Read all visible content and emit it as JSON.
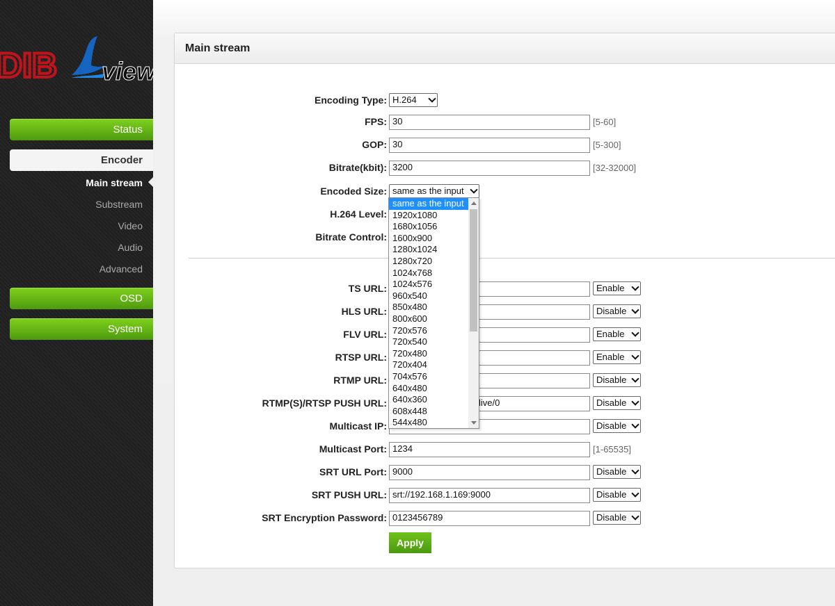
{
  "brand": {
    "part1": "DIB",
    "part2": "view"
  },
  "sidebar": {
    "status": "Status",
    "encoder": "Encoder",
    "encoder_items": [
      "Main stream",
      "Substream",
      "Video",
      "Audio",
      "Advanced"
    ],
    "osd": "OSD",
    "system": "System"
  },
  "panel": {
    "title": "Main stream"
  },
  "form": {
    "encoding_type": {
      "label": "Encoding Type:",
      "value": "H.264"
    },
    "fps": {
      "label": "FPS:",
      "value": "30",
      "range": "[5-60]"
    },
    "gop": {
      "label": "GOP:",
      "value": "30",
      "range": "[5-300]"
    },
    "bitrate": {
      "label": "Bitrate(kbit):",
      "value": "3200",
      "range": "[32-32000]"
    },
    "encoded_size": {
      "label": "Encoded Size:",
      "value": "same as the input"
    },
    "h264_level": {
      "label": "H.264 Level:"
    },
    "bitrate_control": {
      "label": "Bitrate Control:"
    },
    "ts_url": {
      "label": "TS URL:",
      "state": "Enable"
    },
    "hls_url": {
      "label": "HLS URL:",
      "state": "Disable"
    },
    "flv_url": {
      "label": "FLV URL:",
      "state": "Enable"
    },
    "rtsp_url": {
      "label": "RTSP URL:",
      "state": "Enable"
    },
    "rtmp_url": {
      "label": "RTMP URL:",
      "state": "Disable"
    },
    "push_url": {
      "label": "RTMP(S)/RTSP PUSH URL:",
      "value_visible": "live/0",
      "state": "Disable"
    },
    "multicast_ip": {
      "label": "Multicast IP:",
      "state": "Disable"
    },
    "multicast_port": {
      "label": "Multicast Port:",
      "value": "1234",
      "range": "[1-65535]"
    },
    "srt_url_port": {
      "label": "SRT URL Port:",
      "value": "9000",
      "state": "Disable"
    },
    "srt_push_url": {
      "label": "SRT PUSH URL:",
      "value": "srt://192.168.1.169:9000",
      "state": "Disable"
    },
    "srt_password": {
      "label": "SRT Encryption Password:",
      "value": "0123456789",
      "state": "Disable"
    },
    "apply": "Apply"
  },
  "dropdown_options": [
    "same as the input",
    "1920x1080",
    "1680x1056",
    "1600x900",
    "1280x1024",
    "1280x720",
    "1024x768",
    "1024x576",
    "960x540",
    "850x480",
    "800x600",
    "720x576",
    "720x540",
    "720x480",
    "720x404",
    "704x576",
    "640x480",
    "640x360",
    "608x448",
    "544x480"
  ],
  "colors": {
    "accent_green": "#5aad14",
    "selected_blue": "#1e90ff",
    "logo_red": "#c0141c",
    "logo_blue": "#1565c0"
  }
}
